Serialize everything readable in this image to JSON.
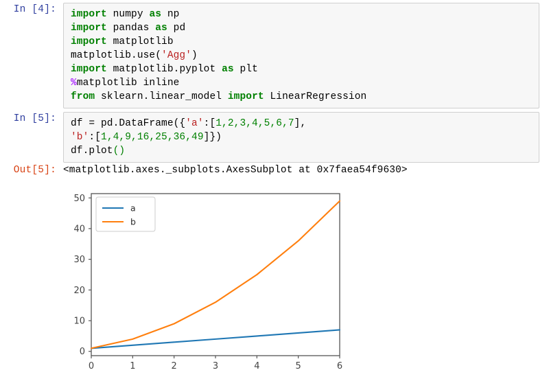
{
  "notebook": {
    "cells": [
      {
        "type": "code",
        "prompt": "In [4]:",
        "source_lines": [
          "import numpy as np",
          "import pandas as pd",
          "import matplotlib",
          "matplotlib.use('Agg')",
          "import matplotlib.pyplot as plt",
          "%matplotlib inline",
          "from sklearn.linear_model import LinearRegression"
        ]
      },
      {
        "type": "code",
        "prompt": "In [5]:",
        "source_lines": [
          "df = pd.DataFrame({'a':[1,2,3,4,5,6,7],",
          "'b':[1,4,9,16,25,36,49]})",
          "df.plot()"
        ]
      },
      {
        "type": "output",
        "prompt": "Out[5]:",
        "text": "<matplotlib.axes._subplots.AxesSubplot at 0x7faea54f9630>"
      }
    ]
  },
  "tokens": {
    "in4": {
      "kw_import": "import",
      "kw_as": "as",
      "kw_from": "from",
      "mod_numpy": "numpy",
      "alias_np": "np",
      "mod_pandas": "pandas",
      "alias_pd": "pd",
      "mod_matplotlib": "matplotlib",
      "call_use": "matplotlib.use(",
      "str_agg": "'Agg'",
      "close_paren": ")",
      "mod_pyplot": "matplotlib.pyplot",
      "alias_plt": "plt",
      "magic_pct": "%",
      "magic_rest": "matplotlib inline",
      "mod_sklearn": "sklearn.linear_model",
      "cls_linreg": "LinearRegression"
    },
    "in5": {
      "assign": "df = pd.DataFrame({",
      "key_a": "'a'",
      "colon": ":[",
      "vals_a": "1,2,3,4,5,6,7",
      "end_a": "],",
      "key_b": "'b'",
      "vals_b": "1,4,9,16,25,36,49",
      "end_b": "]})",
      "plot_call": "df.plot",
      "plot_parens": "()"
    }
  },
  "chart_data": {
    "type": "line",
    "title": "",
    "xlabel": "",
    "ylabel": "",
    "x": [
      0,
      1,
      2,
      3,
      4,
      5,
      6
    ],
    "series": [
      {
        "name": "a",
        "values": [
          1,
          2,
          3,
          4,
          5,
          6,
          7
        ],
        "color": "#1f77b4"
      },
      {
        "name": "b",
        "values": [
          1,
          4,
          9,
          16,
          25,
          36,
          49
        ],
        "color": "#ff7f0e"
      }
    ],
    "xlim": [
      0,
      6
    ],
    "ylim": [
      -1.4,
      51.4
    ],
    "xticks": [
      0,
      1,
      2,
      3,
      4,
      5,
      6
    ],
    "yticks": [
      0,
      10,
      20,
      30,
      40,
      50
    ],
    "xticklabels": [
      "0",
      "1",
      "2",
      "3",
      "4",
      "5",
      "6"
    ],
    "yticklabels": [
      "0",
      "10",
      "20",
      "30",
      "40",
      "50"
    ],
    "grid": false,
    "legend": {
      "position": "upper left",
      "entries": [
        "a",
        "b"
      ]
    },
    "axis_color": "#555555",
    "tick_label_color": "#444444",
    "figure_facecolor": "#ffffff"
  }
}
